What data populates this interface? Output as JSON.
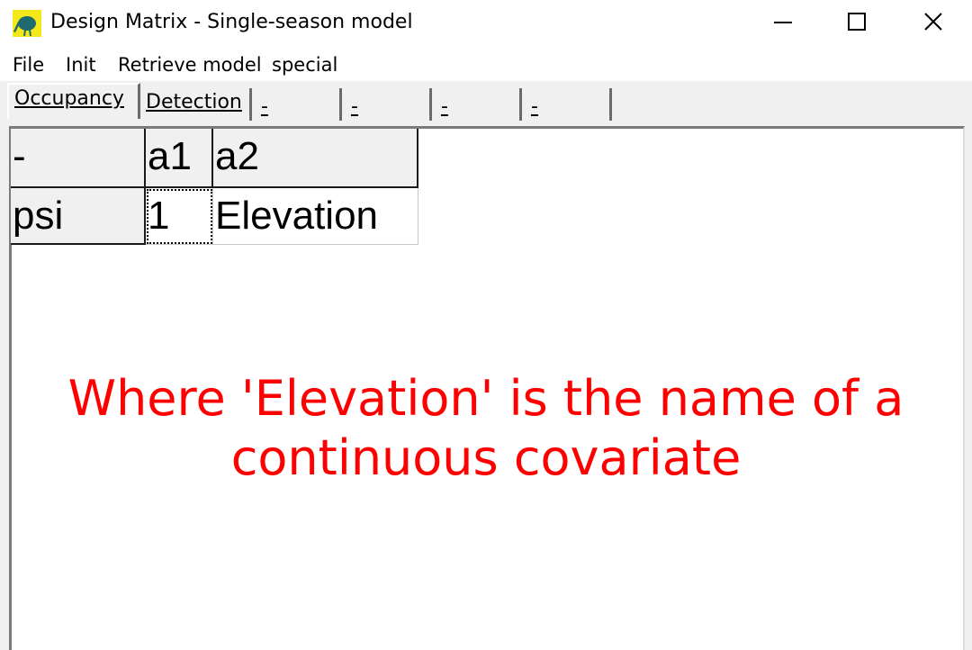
{
  "window": {
    "title": "Design Matrix - Single-season model",
    "icon": "kiwi-bird-icon",
    "controls": [
      "minimize-icon",
      "maximize-icon",
      "close-icon"
    ]
  },
  "menu": {
    "items": [
      "File",
      "Init",
      "Retrieve model",
      "special"
    ]
  },
  "tabs": [
    {
      "label": "Occupancy",
      "active": true
    },
    {
      "label": "Detection",
      "active": false
    },
    {
      "label": "-",
      "active": false
    },
    {
      "label": "-",
      "active": false
    },
    {
      "label": "-",
      "active": false
    },
    {
      "label": "-",
      "active": false
    }
  ],
  "grid": {
    "headers": [
      "-",
      "a1",
      "a2"
    ],
    "rows": [
      {
        "label": "psi",
        "cells": [
          "1",
          "Elevation"
        ]
      }
    ]
  },
  "annotation": {
    "text": "Where 'Elevation' is the name of a continuous covariate",
    "color": "#ff0000"
  }
}
